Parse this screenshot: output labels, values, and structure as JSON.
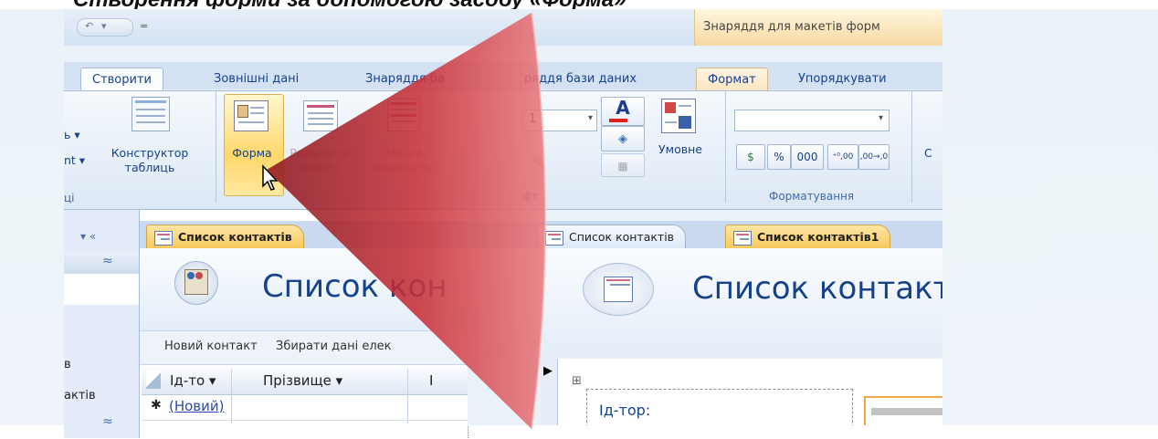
{
  "slide": {
    "title": "Створення форми за допомогою засобу «Форма»"
  },
  "left": {
    "qat_glyphs": [
      "↶",
      "▾",
      "="
    ],
    "tabs": [
      "Створити",
      "Зовнішні дані",
      "Знаряддя ба"
    ],
    "ribbon": {
      "fragment_top": "ь ▾",
      "fragment_bottom": "nt ▾",
      "design_table_label_line1": "Конструктор",
      "design_table_label_line2": "таблиць",
      "forma_label": "Форма",
      "split_form_label_line1": "Розділити",
      "split_form_label_line2": "форму",
      "multi_label_line1": "Кілька",
      "multi_label_line2": "елементів",
      "group_fragment": "ці"
    },
    "nav": {
      "chevrons": "▾  «",
      "collapse_up": "≈",
      "item1": "в",
      "item2": "актів",
      "collapse_down": "≈"
    },
    "doc_tab": "Список контактів",
    "form_title": "Список кон",
    "commands": [
      "Новий контакт",
      "Збирати дані елек"
    ],
    "columns": [
      "Ід-то ▾",
      "Прізвище ▾",
      "І"
    ],
    "new_row_marker": "✱",
    "new_row_value": "(Новий)"
  },
  "right": {
    "contextual_title": "Знаряддя для макетів форм",
    "tabs": [
      "ряддя бази даних",
      "Формат",
      "Упорядкувати"
    ],
    "ribbon": {
      "font_size": "1",
      "conditional_label": "Умовне",
      "percent": "%",
      "thousands": "000",
      "dec_inc": "⁺⁰,00",
      "dec_dec": ",00→,0",
      "group_font": "фт",
      "group_formatting": "Форматування",
      "edge_label": "С"
    },
    "doc_tabs": [
      "Список контактів",
      "Список контактів1"
    ],
    "form_title": "Список контакт",
    "field_label": "Ід-тор:",
    "record_arrow": "▶",
    "move_handle": "⊞"
  },
  "colors": {
    "spotlight_red": "#c8323a",
    "ribbon_blue": "#15428b",
    "active_orange": "#f7c85a"
  }
}
